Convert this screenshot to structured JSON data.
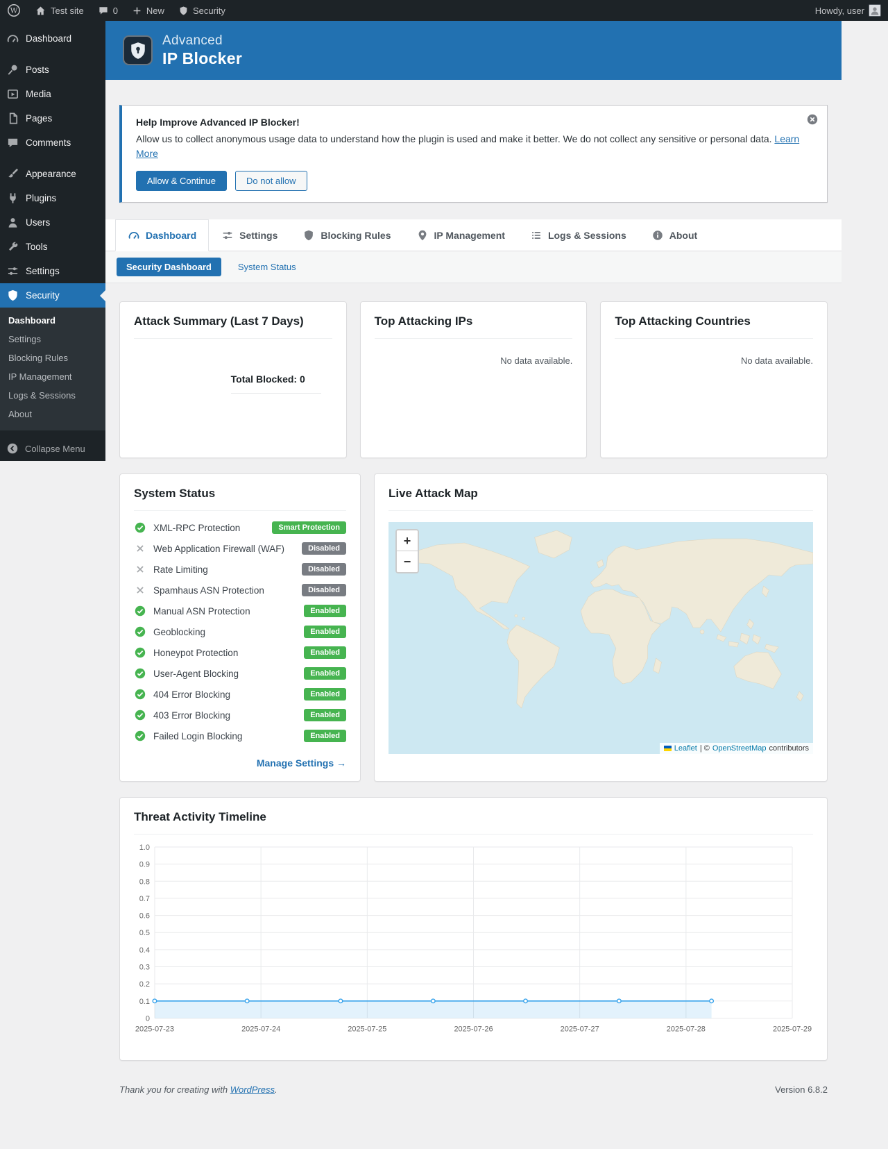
{
  "admin_bar": {
    "site_name": "Test site",
    "comments_count": "0",
    "new_label": "New",
    "security_label": "Security",
    "howdy": "Howdy, user"
  },
  "sidebar": {
    "items": [
      {
        "label": "Dashboard"
      },
      {
        "label": "Posts"
      },
      {
        "label": "Media"
      },
      {
        "label": "Pages"
      },
      {
        "label": "Comments"
      },
      {
        "label": "Appearance"
      },
      {
        "label": "Plugins"
      },
      {
        "label": "Users"
      },
      {
        "label": "Tools"
      },
      {
        "label": "Settings"
      },
      {
        "label": "Security"
      }
    ],
    "submenu": [
      "Dashboard",
      "Settings",
      "Blocking Rules",
      "IP Management",
      "Logs & Sessions",
      "About"
    ],
    "collapse": "Collapse Menu"
  },
  "header": {
    "title_line1": "Advanced",
    "title_line2": "IP Blocker"
  },
  "notice": {
    "title": "Help Improve Advanced IP Blocker!",
    "body": "Allow us to collect anonymous usage data to understand how the plugin is used and make it better. We do not collect any sensitive or personal data.",
    "learn_more": "Learn More",
    "allow_button": "Allow & Continue",
    "deny_button": "Do not allow"
  },
  "tabs": [
    {
      "label": "Dashboard"
    },
    {
      "label": "Settings"
    },
    {
      "label": "Blocking Rules"
    },
    {
      "label": "IP Management"
    },
    {
      "label": "Logs & Sessions"
    },
    {
      "label": "About"
    }
  ],
  "subtabs": {
    "active": "Security Dashboard",
    "other": "System Status"
  },
  "cards": {
    "attack_summary": {
      "title": "Attack Summary (Last 7 Days)",
      "total": "Total Blocked: 0"
    },
    "top_ips": {
      "title": "Top Attacking IPs",
      "empty": "No data available."
    },
    "top_countries": {
      "title": "Top Attacking Countries",
      "empty": "No data available."
    }
  },
  "system_status": {
    "title": "System Status",
    "rows": [
      {
        "label": "XML-RPC Protection",
        "status": "Smart Protection",
        "state": "enabled"
      },
      {
        "label": "Web Application Firewall (WAF)",
        "status": "Disabled",
        "state": "disabled"
      },
      {
        "label": "Rate Limiting",
        "status": "Disabled",
        "state": "disabled"
      },
      {
        "label": "Spamhaus ASN Protection",
        "status": "Disabled",
        "state": "disabled"
      },
      {
        "label": "Manual ASN Protection",
        "status": "Enabled",
        "state": "enabled"
      },
      {
        "label": "Geoblocking",
        "status": "Enabled",
        "state": "enabled"
      },
      {
        "label": "Honeypot Protection",
        "status": "Enabled",
        "state": "enabled"
      },
      {
        "label": "User-Agent Blocking",
        "status": "Enabled",
        "state": "enabled"
      },
      {
        "label": "404 Error Blocking",
        "status": "Enabled",
        "state": "enabled"
      },
      {
        "label": "403 Error Blocking",
        "status": "Enabled",
        "state": "enabled"
      },
      {
        "label": "Failed Login Blocking",
        "status": "Enabled",
        "state": "enabled"
      }
    ],
    "manage_link": "Manage Settings →"
  },
  "map": {
    "title": "Live Attack Map",
    "zoom_in": "+",
    "zoom_out": "−",
    "attribution": {
      "leaflet": "Leaflet",
      "separator": "| ©",
      "osm": "OpenStreetMap",
      "contributors": "contributors"
    }
  },
  "chart_data": {
    "type": "line",
    "title": "Threat Activity Timeline",
    "x_tick_labels": [
      "2025-07-23",
      "2025-07-24",
      "2025-07-25",
      "2025-07-26",
      "2025-07-27",
      "2025-07-28",
      "2025-07-29"
    ],
    "x_range_days": [
      0,
      6
    ],
    "ylim": [
      0,
      1
    ],
    "y_ticks": [
      0,
      0.1,
      0.2,
      0.3,
      0.4,
      0.5,
      0.6,
      0.7,
      0.8,
      0.9,
      1.0
    ],
    "grid": true,
    "legend": false,
    "series": [
      {
        "color": "#36a2eb",
        "fill_opacity": 0.14,
        "points": [
          {
            "x": 0,
            "y": 0.1
          },
          {
            "x": 0.87,
            "y": 0.1
          },
          {
            "x": 1.75,
            "y": 0.1
          },
          {
            "x": 2.62,
            "y": 0.1
          },
          {
            "x": 3.49,
            "y": 0.1
          },
          {
            "x": 4.37,
            "y": 0.1
          },
          {
            "x": 5.24,
            "y": 0.1
          }
        ]
      }
    ]
  },
  "footer": {
    "thanks_prefix": "Thank you for creating with",
    "wordpress_link": "WordPress",
    "period": ".",
    "version": "Version 6.8.2"
  }
}
